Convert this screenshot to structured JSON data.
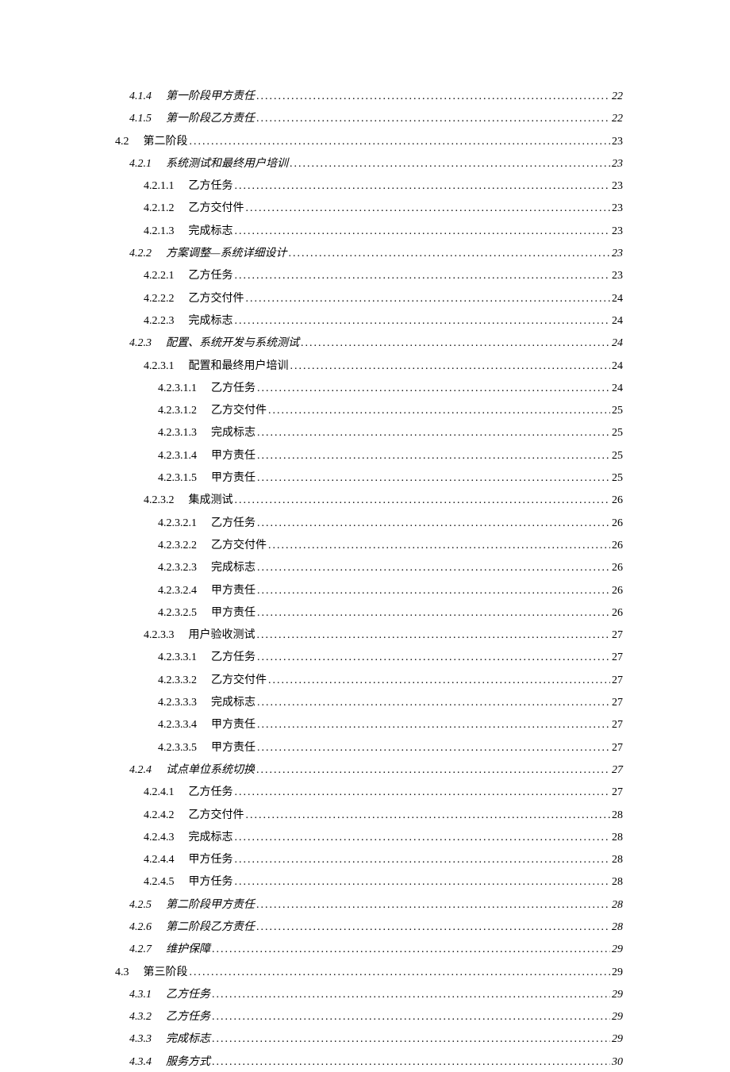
{
  "toc": [
    {
      "number": "4.1.4",
      "title": "第一阶段甲方责任",
      "page": "22",
      "indent": 1,
      "italic": true
    },
    {
      "number": "4.1.5",
      "title": "第一阶段乙方责任",
      "page": "22",
      "indent": 1,
      "italic": true
    },
    {
      "number": "4.2",
      "title": "第二阶段",
      "page": "23",
      "indent": 2,
      "italic": false
    },
    {
      "number": "4.2.1",
      "title": "系统测试和最终用户培训",
      "page": "23",
      "indent": 1,
      "italic": true
    },
    {
      "number": "4.2.1.1",
      "title": "乙方任务",
      "page": "23",
      "indent": 3,
      "italic": false
    },
    {
      "number": "4.2.1.2",
      "title": "乙方交付件",
      "page": "23",
      "indent": 3,
      "italic": false
    },
    {
      "number": "4.2.1.3",
      "title": "完成标志",
      "page": "23",
      "indent": 3,
      "italic": false
    },
    {
      "number": "4.2.2",
      "title": "方案调整—系统详细设计",
      "page": "23",
      "indent": 1,
      "italic": true
    },
    {
      "number": "4.2.2.1",
      "title": "乙方任务",
      "page": "23",
      "indent": 3,
      "italic": false
    },
    {
      "number": "4.2.2.2",
      "title": "乙方交付件",
      "page": "24",
      "indent": 3,
      "italic": false
    },
    {
      "number": "4.2.2.3",
      "title": "完成标志",
      "page": "24",
      "indent": 3,
      "italic": false
    },
    {
      "number": "4.2.3",
      "title": "配置、系统开发与系统测试",
      "page": "24",
      "indent": 1,
      "italic": true
    },
    {
      "number": "4.2.3.1",
      "title": "配置和最终用户培训",
      "page": "24",
      "indent": 3,
      "italic": false
    },
    {
      "number": "4.2.3.1.1",
      "title": "乙方任务",
      "page": "24",
      "indent": 4,
      "italic": false
    },
    {
      "number": "4.2.3.1.2",
      "title": "乙方交付件",
      "page": "25",
      "indent": 4,
      "italic": false
    },
    {
      "number": "4.2.3.1.3",
      "title": "完成标志",
      "page": "25",
      "indent": 4,
      "italic": false
    },
    {
      "number": "4.2.3.1.4",
      "title": "甲方责任",
      "page": "25",
      "indent": 4,
      "italic": false
    },
    {
      "number": "4.2.3.1.5",
      "title": "甲方责任",
      "page": "25",
      "indent": 4,
      "italic": false
    },
    {
      "number": "4.2.3.2",
      "title": "集成测试",
      "page": "26",
      "indent": 3,
      "italic": false
    },
    {
      "number": "4.2.3.2.1",
      "title": "乙方任务",
      "page": "26",
      "indent": 4,
      "italic": false
    },
    {
      "number": "4.2.3.2.2",
      "title": "乙方交付件",
      "page": "26",
      "indent": 4,
      "italic": false
    },
    {
      "number": "4.2.3.2.3",
      "title": "完成标志",
      "page": "26",
      "indent": 4,
      "italic": false
    },
    {
      "number": "4.2.3.2.4",
      "title": "甲方责任",
      "page": "26",
      "indent": 4,
      "italic": false
    },
    {
      "number": "4.2.3.2.5",
      "title": "甲方责任",
      "page": "26",
      "indent": 4,
      "italic": false
    },
    {
      "number": "4.2.3.3",
      "title": "用户验收测试",
      "page": "27",
      "indent": 3,
      "italic": false
    },
    {
      "number": "4.2.3.3.1",
      "title": "乙方任务",
      "page": "27",
      "indent": 4,
      "italic": false
    },
    {
      "number": "4.2.3.3.2",
      "title": "乙方交付件",
      "page": "27",
      "indent": 4,
      "italic": false
    },
    {
      "number": "4.2.3.3.3",
      "title": "完成标志",
      "page": "27",
      "indent": 4,
      "italic": false
    },
    {
      "number": "4.2.3.3.4",
      "title": "甲方责任",
      "page": "27",
      "indent": 4,
      "italic": false
    },
    {
      "number": "4.2.3.3.5",
      "title": "甲方责任",
      "page": "27",
      "indent": 4,
      "italic": false
    },
    {
      "number": "4.2.4",
      "title": "试点单位系统切换",
      "page": "27",
      "indent": 1,
      "italic": true
    },
    {
      "number": "4.2.4.1",
      "title": "乙方任务",
      "page": "27",
      "indent": 3,
      "italic": false
    },
    {
      "number": "4.2.4.2",
      "title": "乙方交付件",
      "page": "28",
      "indent": 3,
      "italic": false
    },
    {
      "number": "4.2.4.3",
      "title": "完成标志",
      "page": "28",
      "indent": 3,
      "italic": false
    },
    {
      "number": "4.2.4.4",
      "title": "甲方任务",
      "page": "28",
      "indent": 3,
      "italic": false
    },
    {
      "number": "4.2.4.5",
      "title": "甲方任务",
      "page": "28",
      "indent": 3,
      "italic": false
    },
    {
      "number": "4.2.5",
      "title": "第二阶段甲方责任",
      "page": "28",
      "indent": 1,
      "italic": true
    },
    {
      "number": "4.2.6",
      "title": "第二阶段乙方责任",
      "page": "28",
      "indent": 1,
      "italic": true
    },
    {
      "number": "4.2.7",
      "title": "维护保障",
      "page": "29",
      "indent": 1,
      "italic": true
    },
    {
      "number": "4.3",
      "title": "第三阶段",
      "page": "29",
      "indent": 2,
      "italic": false
    },
    {
      "number": "4.3.1",
      "title": "乙方任务",
      "page": "29",
      "indent": 1,
      "italic": true
    },
    {
      "number": "4.3.2",
      "title": "乙方任务",
      "page": "29",
      "indent": 1,
      "italic": true
    },
    {
      "number": "4.3.3",
      "title": "完成标志",
      "page": "29",
      "indent": 1,
      "italic": true
    },
    {
      "number": "4.3.4",
      "title": "服务方式",
      "page": "30",
      "indent": 1,
      "italic": true
    }
  ]
}
